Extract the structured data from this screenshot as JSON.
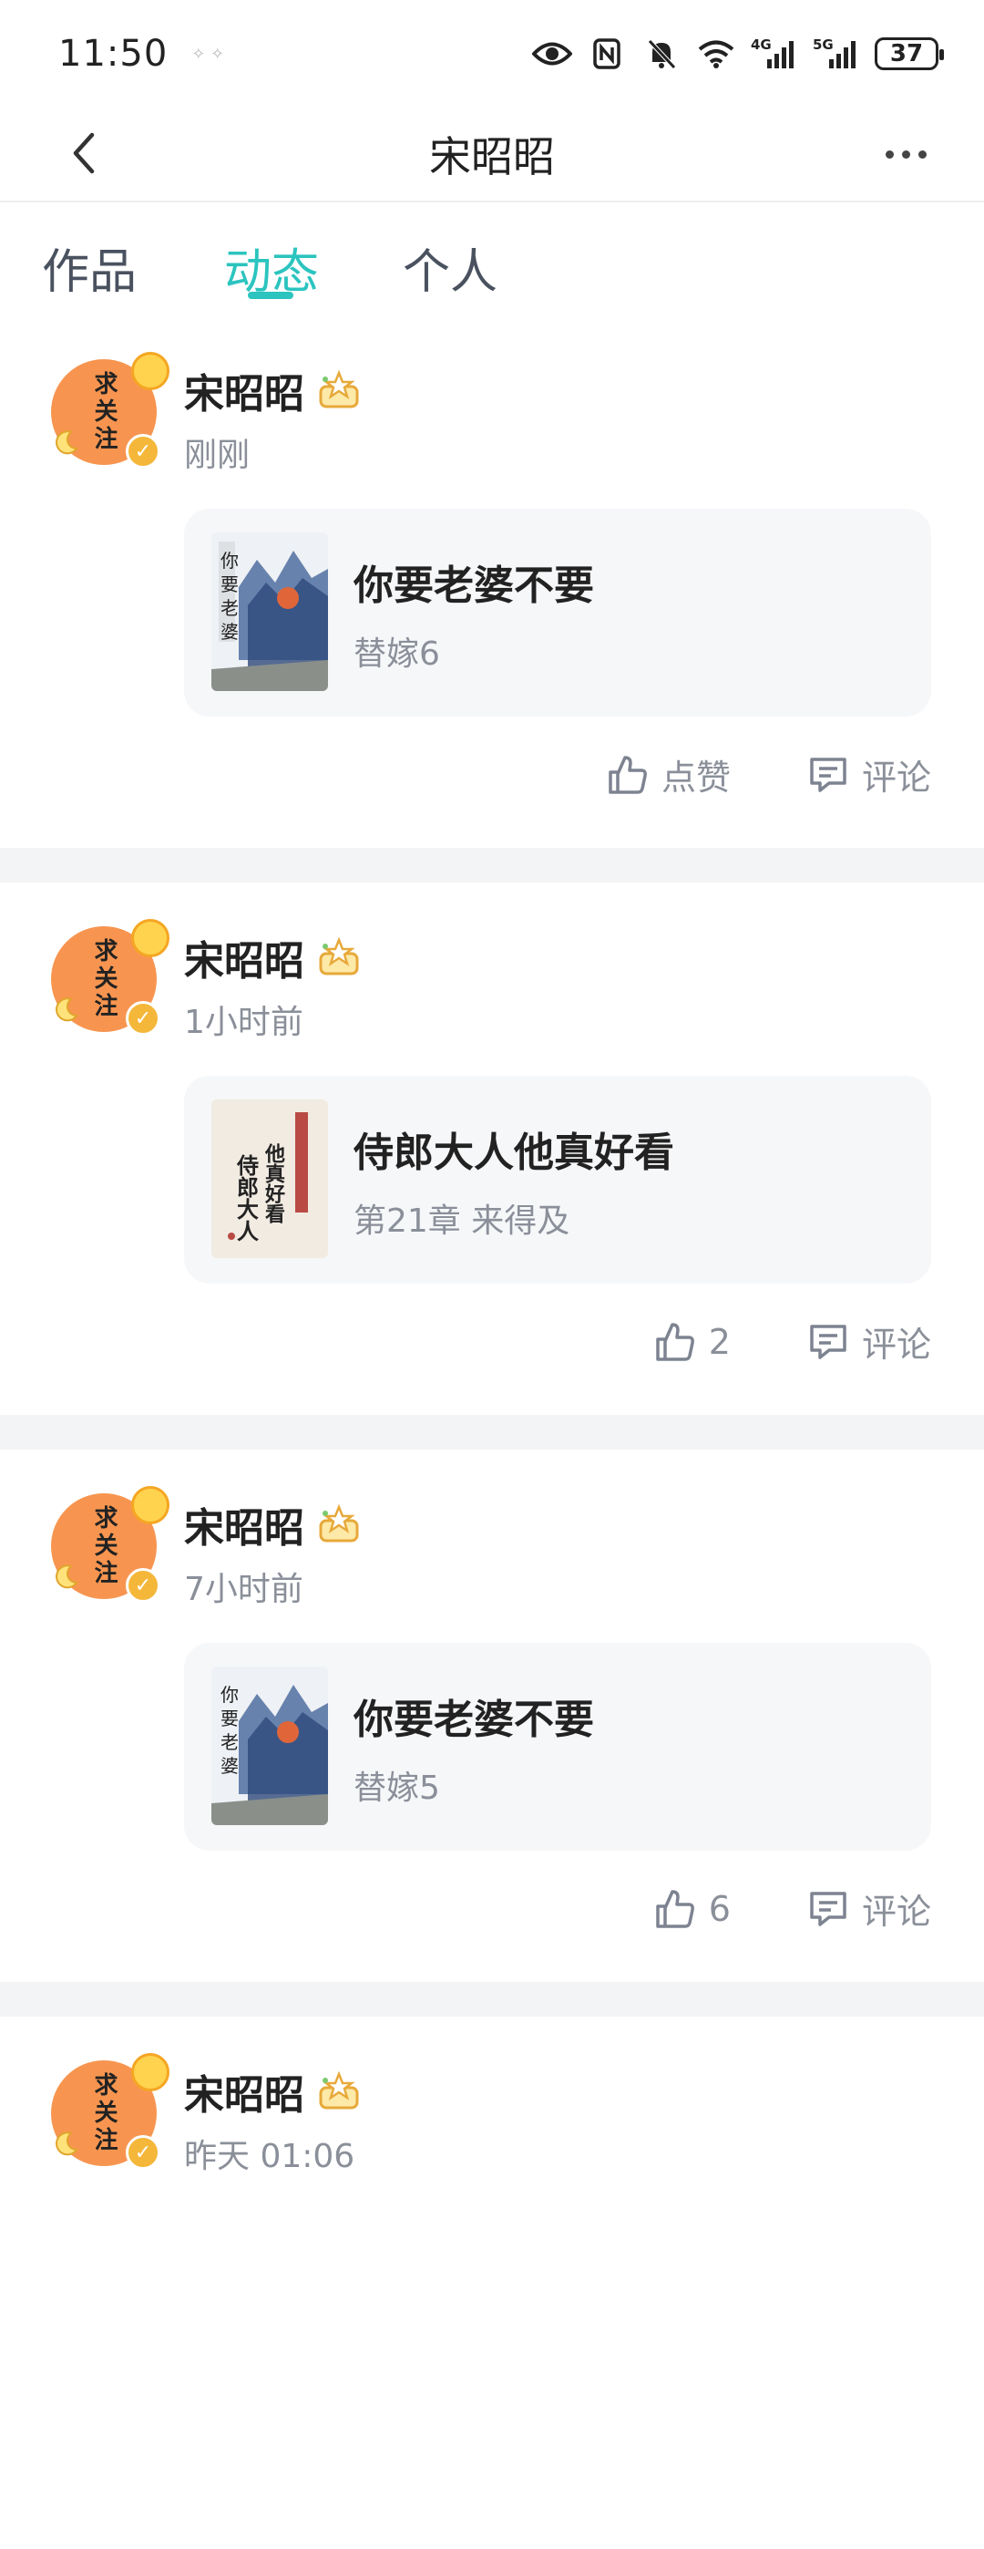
{
  "status_bar": {
    "time": "11:50",
    "battery": "37",
    "icons": [
      "eye-icon",
      "nfc-icon",
      "mute-bell-icon",
      "wifi-icon",
      "signal-4g-icon",
      "signal-5g-icon",
      "battery-icon"
    ],
    "net1": "4G",
    "net2": "5G"
  },
  "nav": {
    "title": "宋昭昭",
    "back_icon": "chevron-left-icon",
    "more_icon": "more-dots-icon"
  },
  "tabs": [
    {
      "label": "作品",
      "active": false
    },
    {
      "label": "动态",
      "active": true
    },
    {
      "label": "个人",
      "active": false
    }
  ],
  "accent_color": "#2bc4bf",
  "avatar_text": "求关注",
  "posts": [
    {
      "author": "宋昭昭",
      "time": "刚刚",
      "book_title": "你要老婆不要",
      "book_sub": "替嫁6",
      "cover": "ink-landscape",
      "like_label": "点赞",
      "comment_label": "评论"
    },
    {
      "author": "宋昭昭",
      "time": "1小时前",
      "book_title": "侍郎大人他真好看",
      "book_sub": "第21章 来得及",
      "cover": "calligraphy",
      "cover_text_a": "侍郎大人",
      "cover_text_b": "他真好看",
      "like_label": "2",
      "comment_label": "评论"
    },
    {
      "author": "宋昭昭",
      "time": "7小时前",
      "book_title": "你要老婆不要",
      "book_sub": "替嫁5",
      "cover": "ink-landscape",
      "like_label": "6",
      "comment_label": "评论"
    },
    {
      "author": "宋昭昭",
      "time": "昨天 01:06"
    }
  ]
}
